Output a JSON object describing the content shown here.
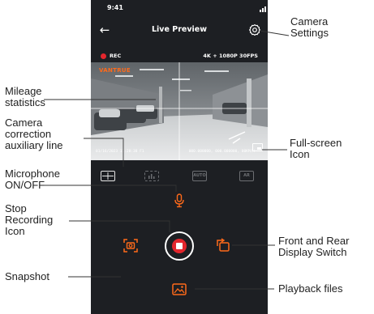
{
  "status_bar": {
    "time": "9:41"
  },
  "nav": {
    "back_icon": "back-arrow-icon",
    "title": "Live Preview",
    "settings_icon": "gear-icon"
  },
  "recording": {
    "indicator": "REC",
    "resolution": "4K + 1080P 30FPS"
  },
  "video": {
    "logo": "VANTRUE",
    "timestamp": "01/16/2023  11:28:38  F1",
    "gps_readout": "000.000000, 000.000000, 00KM/H"
  },
  "toolbar": {
    "buttons": [
      {
        "name": "grid",
        "label": ""
      },
      {
        "name": "mileage",
        "label": ""
      },
      {
        "name": "auto",
        "label": "AUTO"
      },
      {
        "name": "ar",
        "label": "AR"
      }
    ]
  },
  "colors": {
    "accent": "#ff6a1a",
    "record_red": "#e3262d",
    "background": "#1d1f23"
  },
  "annotations": {
    "camera_settings": [
      "Camera",
      "Settings"
    ],
    "mileage": [
      "Mileage",
      "statistics"
    ],
    "correction": [
      "Camera",
      "correction",
      "auxiliary line"
    ],
    "full_screen": [
      "Full-screen",
      "Icon"
    ],
    "microphone": [
      "Microphone",
      "ON/OFF"
    ],
    "stop_recording": [
      "Stop",
      "Recording",
      "Icon"
    ],
    "front_rear": [
      "Front and Rear",
      "Display Switch"
    ],
    "snapshot": [
      "Snapshot"
    ],
    "playback": [
      "Playback files"
    ]
  }
}
